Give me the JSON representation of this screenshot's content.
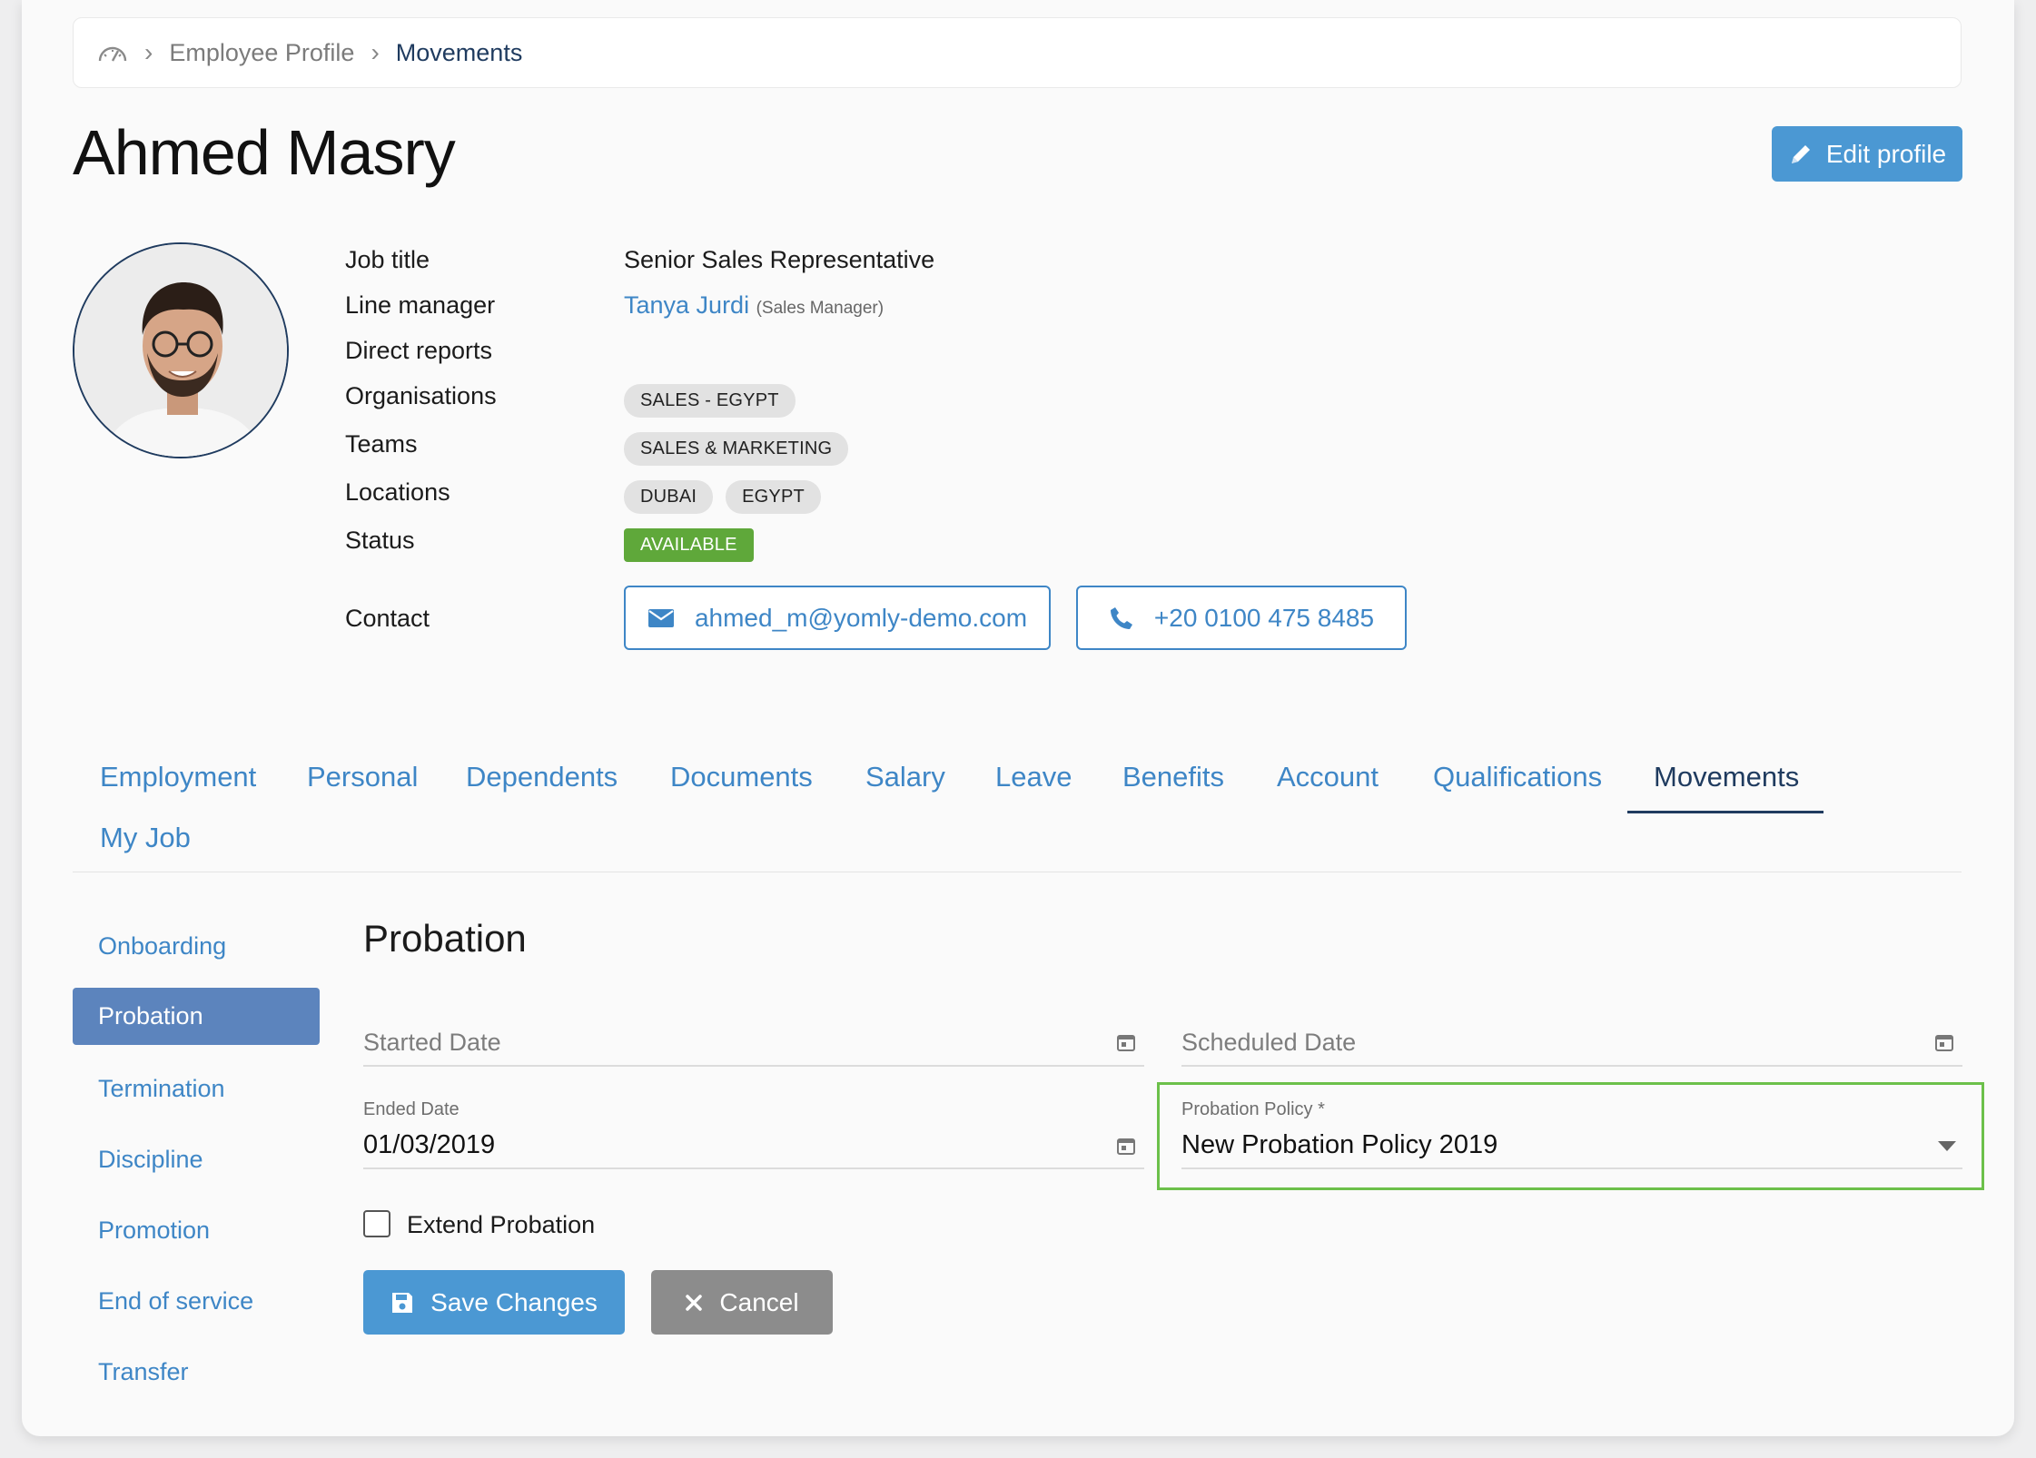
{
  "breadcrumb": {
    "home_icon": "speedometer-icon",
    "items": [
      "Employee Profile",
      "Movements"
    ]
  },
  "page": {
    "title": "Ahmed Masry",
    "edit_label": "Edit profile"
  },
  "profile": {
    "fields": {
      "job_title": {
        "label": "Job title",
        "value": "Senior Sales Representative"
      },
      "line_manager": {
        "label": "Line manager",
        "name": "Tanya Jurdi",
        "role": "(Sales Manager)"
      },
      "direct_reports": {
        "label": "Direct reports"
      },
      "organisations": {
        "label": "Organisations",
        "chips": [
          "SALES - EGYPT"
        ]
      },
      "teams": {
        "label": "Teams",
        "chips": [
          "SALES & MARKETING"
        ]
      },
      "locations": {
        "label": "Locations",
        "chips": [
          "DUBAI",
          "EGYPT"
        ]
      },
      "status": {
        "label": "Status",
        "value": "AVAILABLE"
      },
      "contact": {
        "label": "Contact",
        "email": "ahmed_m@yomly-demo.com",
        "phone": "+20 0100 475 8485"
      }
    }
  },
  "tabs": [
    "Employment",
    "Personal",
    "Dependents",
    "Documents",
    "Salary",
    "Leave",
    "Benefits",
    "Account",
    "Qualifications",
    "Movements",
    "My Job"
  ],
  "active_tab": "Movements",
  "side_nav": [
    "Onboarding",
    "Probation",
    "Termination",
    "Discipline",
    "Promotion",
    "End of service",
    "Transfer"
  ],
  "active_side": "Probation",
  "probation": {
    "title": "Probation",
    "started_date": {
      "label": "Started Date",
      "value": ""
    },
    "scheduled_date": {
      "label": "Scheduled Date",
      "value": ""
    },
    "ended_date": {
      "label": "Ended Date",
      "value": "01/03/2019"
    },
    "policy": {
      "label": "Probation Policy *",
      "value": "New Probation Policy 2019"
    },
    "extend_label": "Extend Probation",
    "extend_checked": false,
    "save_label": "Save Changes",
    "cancel_label": "Cancel"
  },
  "colors": {
    "accent": "#4b98d3",
    "link": "#3e86c6",
    "navy": "#1f3b5f",
    "status_green": "#5fa83a",
    "highlight": "#6cc04a"
  }
}
